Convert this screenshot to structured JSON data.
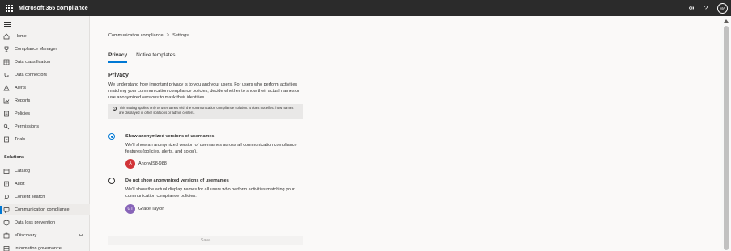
{
  "app": {
    "title": "Microsoft 365 compliance",
    "user_initials": "MA"
  },
  "topbar": {
    "icons": [
      "waffle-icon",
      "gear-icon",
      "help-icon"
    ]
  },
  "nav": {
    "items": [
      {
        "label": "Home",
        "icon": "home-icon"
      },
      {
        "label": "Compliance Manager",
        "icon": "trophy-icon"
      },
      {
        "label": "Data classification",
        "icon": "classification-icon"
      },
      {
        "label": "Data connectors",
        "icon": "connector-icon"
      },
      {
        "label": "Alerts",
        "icon": "alert-icon"
      },
      {
        "label": "Reports",
        "icon": "chart-icon"
      },
      {
        "label": "Policies",
        "icon": "policies-icon"
      },
      {
        "label": "Permissions",
        "icon": "key-icon"
      },
      {
        "label": "Trials",
        "icon": "trials-icon"
      }
    ],
    "section_label": "Solutions",
    "solutions": [
      {
        "label": "Catalog",
        "icon": "catalog-icon"
      },
      {
        "label": "Audit",
        "icon": "audit-icon"
      },
      {
        "label": "Content search",
        "icon": "search-icon"
      },
      {
        "label": "Communication compliance",
        "icon": "communication-icon",
        "selected": true
      },
      {
        "label": "Data loss prevention",
        "icon": "dlp-icon"
      },
      {
        "label": "eDiscovery",
        "icon": "ediscovery-icon",
        "expandable": true
      },
      {
        "label": "Information governance",
        "icon": "governance-icon"
      }
    ]
  },
  "breadcrumb": {
    "items": [
      "Communication compliance",
      "Settings"
    ],
    "separator": ">"
  },
  "tabs": [
    {
      "label": "Privacy",
      "active": true
    },
    {
      "label": "Notice templates",
      "active": false
    }
  ],
  "privacy": {
    "title": "Privacy",
    "description": "We understand how important privacy is to you and your users. For users who perform activities matching your communication compliance policies, decide whether to show their actual names or use anonymized versions to mask their identities.",
    "info": "This setting applies only to usernames with the communication compliance solution. It does not effect how names are displayed in other solutions or admin centers.",
    "options": [
      {
        "title": "Show anonymized versions of usernames",
        "description": "We'll show an anonymized version of usernames across all communication compliance features (policies, alerts, and so on).",
        "selected": true,
        "example": {
          "initials": "A",
          "name": "AnonyIS8-988",
          "color": "#d13438"
        }
      },
      {
        "title": "Do not show anonymized versions of usernames",
        "description": "We'll show the actual display names for all users who perform activities matching your communication compliance policies.",
        "selected": false,
        "example": {
          "initials": "GT",
          "name": "Grace Taylor",
          "color": "#8764b8"
        }
      }
    ],
    "save_label": "Save"
  },
  "colors": {
    "accent": "#0078d4",
    "topbar": "#2b2b2b",
    "nav_bg": "#f3f2f1"
  }
}
